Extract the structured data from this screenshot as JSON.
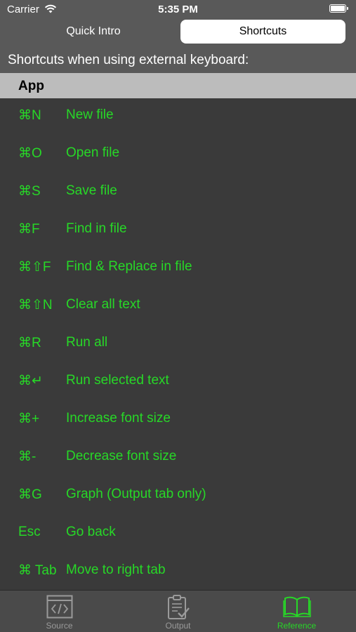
{
  "status": {
    "carrier": "Carrier",
    "time": "5:35 PM"
  },
  "segments": {
    "intro": "Quick Intro",
    "shortcuts": "Shortcuts"
  },
  "heading": "Shortcuts when using external keyboard:",
  "section": {
    "title": "App"
  },
  "shortcuts": [
    {
      "key": "⌘N",
      "desc": "New file"
    },
    {
      "key": "⌘O",
      "desc": "Open file"
    },
    {
      "key": "⌘S",
      "desc": "Save file"
    },
    {
      "key": "⌘F",
      "desc": "Find in file"
    },
    {
      "key": "⌘⇧F",
      "desc": "Find & Replace in file"
    },
    {
      "key": "⌘⇧N",
      "desc": "Clear all text"
    },
    {
      "key": "⌘R",
      "desc": "Run all"
    },
    {
      "key": "⌘↵",
      "desc": "Run selected text"
    },
    {
      "key": "⌘+",
      "desc": "Increase font size"
    },
    {
      "key": "⌘-",
      "desc": "Decrease font size"
    },
    {
      "key": "⌘G",
      "desc": "Graph (Output tab only)"
    },
    {
      "key": "Esc",
      "desc": "Go back"
    },
    {
      "key": "⌘ Tab",
      "desc": "Move to right tab"
    }
  ],
  "tabs": [
    {
      "label": "Source",
      "icon": "code-icon"
    },
    {
      "label": "Output",
      "icon": "clipboard-check-icon"
    },
    {
      "label": "Reference",
      "icon": "book-icon",
      "active": true
    }
  ],
  "colors": {
    "accent": "#27d827",
    "background": "#3a3a3a",
    "section": "#bcbcbc"
  }
}
